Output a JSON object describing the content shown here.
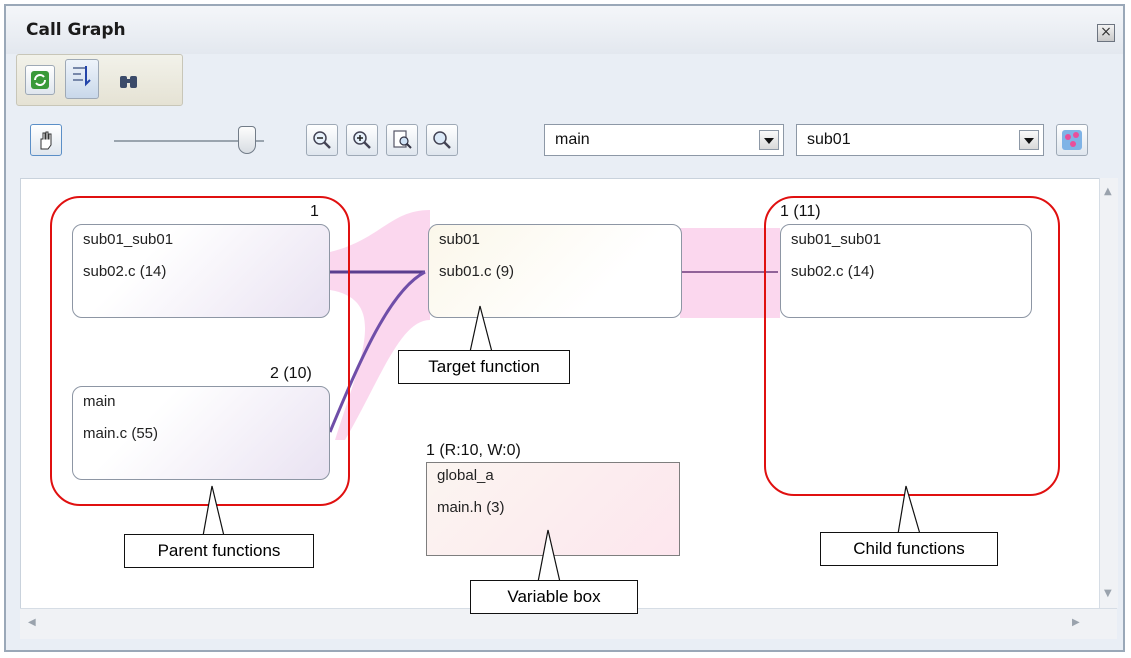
{
  "window": {
    "title": "Call Graph",
    "close_icon": "close-icon"
  },
  "toolbar": {
    "refresh_icon": "refresh-icon",
    "display_icon": "display-mode-icon",
    "find_icon": "find-icon"
  },
  "controls": {
    "hand_icon": "hand-icon",
    "zoom_out_icon": "zoom-out-icon",
    "zoom_in_icon": "zoom-in-icon",
    "fit_icon": "fit-page-icon",
    "search_icon": "search-icon",
    "caller_select": "main",
    "callee_select": "sub01",
    "layout_icon": "layout-icon"
  },
  "graph": {
    "parents": [
      {
        "name": "sub01_sub01",
        "file": "sub02.c  (14)",
        "count": "1"
      },
      {
        "name": "main",
        "file": "main.c  (55)",
        "count": "2 (10)"
      }
    ],
    "target": {
      "name": "sub01",
      "file": "sub01.c  (9)"
    },
    "children": [
      {
        "name": "sub01_sub01",
        "file": "sub02.c  (14)",
        "count": "1 (11)"
      }
    ],
    "variable": {
      "name": "global_a",
      "file": "main.h  (3)",
      "count": "1 (R:10, W:0)"
    }
  },
  "callouts": {
    "target": "Target function",
    "parents": "Parent functions",
    "variable": "Variable box",
    "children": "Child functions"
  },
  "colors": {
    "group_outline": "#e01010",
    "call_line": "#5a3e8e",
    "highlight": "#f7b6e0"
  }
}
